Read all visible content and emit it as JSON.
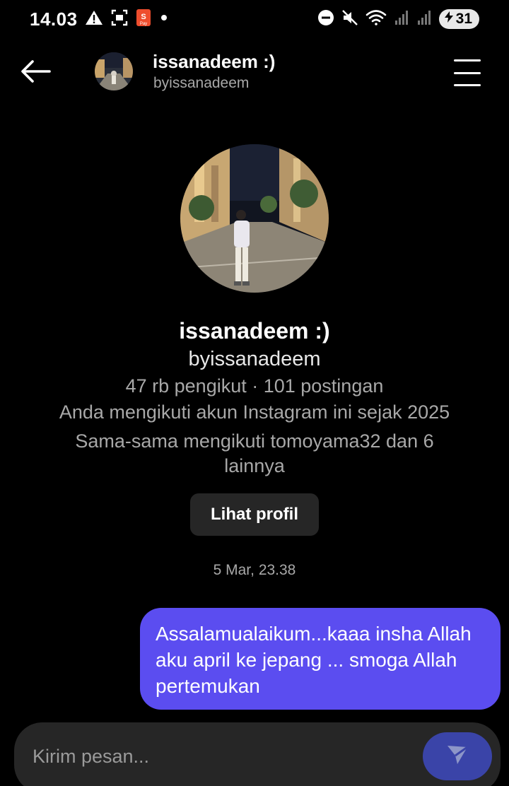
{
  "status_bar": {
    "time": "14.03",
    "battery": "31",
    "left_icons": [
      "warning-icon",
      "screenshot-icon",
      "shopeepay-icon",
      "dot-icon"
    ],
    "right_icons": [
      "dnd-icon",
      "mute-icon",
      "wifi-icon",
      "signal-icon",
      "signal-icon",
      "battery-icon"
    ]
  },
  "header": {
    "name": "issanadeem :)",
    "username": "byissanadeem"
  },
  "profile": {
    "name": "issanadeem :)",
    "username": "byissanadeem",
    "stats": "47 rb pengikut · 101 postingan",
    "following_since": "Anda mengikuti akun Instagram ini sejak 2025",
    "mutual": "Sama-sama mengikuti tomoyama32 dan 6 lainnya",
    "view_profile_label": "Lihat profil"
  },
  "conversation": {
    "timestamp": "5 Mar, 23.38",
    "messages": [
      {
        "sender": "me",
        "text": "Assalamualaikum...kaaa insha Allah aku april ke jepang ... smoga Allah pertemukan"
      }
    ]
  },
  "composer": {
    "placeholder": "Kirim pesan..."
  },
  "colors": {
    "background": "#000000",
    "bubble": "#5b4df0",
    "send_button": "#3a44a8",
    "secondary_text": "#a8a8a8",
    "button_bg": "#262626"
  }
}
